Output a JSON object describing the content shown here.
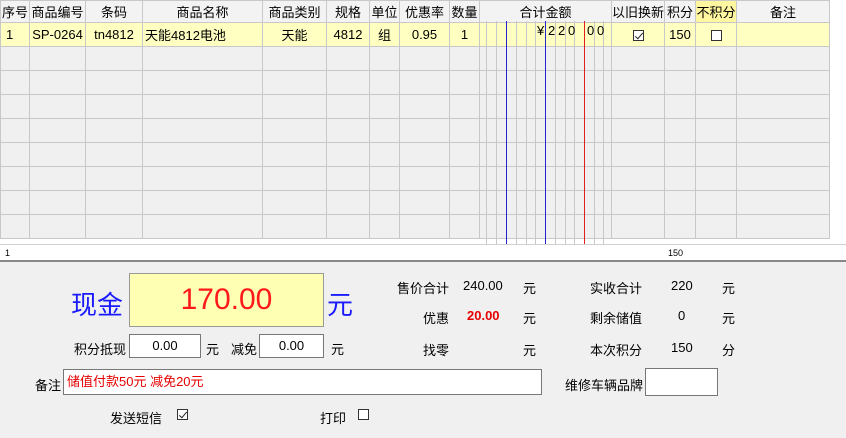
{
  "table": {
    "headers": {
      "seq": "序号",
      "code": "商品编号",
      "barcode": "条码",
      "name": "商品名称",
      "category": "商品类别",
      "spec": "规格",
      "unit": "单位",
      "discount_rate": "优惠率",
      "qty": "数量",
      "total": "合计金额",
      "trade_in": "以旧换新",
      "points": "积分",
      "no_points": "不积分",
      "remark": "备注"
    },
    "rows": [
      {
        "seq": "1",
        "code": "SP-0264",
        "barcode": "tn4812",
        "name": "天能4812电池",
        "category": "天能",
        "spec": "4812",
        "unit": "组",
        "discount_rate": "0.95",
        "qty": "1",
        "currency": "¥",
        "amount_digits": [
          "2",
          "2",
          "0",
          "0",
          "0"
        ],
        "trade_in_checked": true,
        "points": "150",
        "no_points_checked": false,
        "remark": ""
      }
    ],
    "footer": {
      "count": "1",
      "points_total": "150"
    }
  },
  "payment": {
    "method_label": "现金",
    "amount": "170.00",
    "currency_unit": "元",
    "points_deduct_label": "积分抵现",
    "points_deduct_value": "0.00",
    "points_deduct_unit": "元",
    "waive_label": "减免",
    "waive_value": "0.00",
    "waive_unit": "元"
  },
  "summary": {
    "sale_total_label": "售价合计",
    "sale_total_value": "240.00",
    "sale_total_unit": "元",
    "discount_label": "优惠",
    "discount_value": "20.00",
    "discount_unit": "元",
    "change_label": "找零",
    "change_value": "",
    "change_unit": "元",
    "received_label": "实收合计",
    "received_value": "220",
    "received_unit": "元",
    "balance_label": "剩余储值",
    "balance_value": "0",
    "balance_unit": "元",
    "points_label": "本次积分",
    "points_value": "150",
    "points_unit": "分"
  },
  "note": {
    "label": "备注",
    "value": "储值付款50元 减免20元"
  },
  "vehicle_brand": {
    "label": "维修车辆品牌",
    "value": ""
  },
  "options": {
    "sms_label": "发送短信",
    "sms_checked": true,
    "print_label": "打印",
    "print_checked": false
  },
  "colors": {
    "cash_text": "#ff1a1a",
    "cash_bg": "#ffffb3",
    "label_blue": "#1a1aff",
    "selected_row": "#ffffc2"
  }
}
